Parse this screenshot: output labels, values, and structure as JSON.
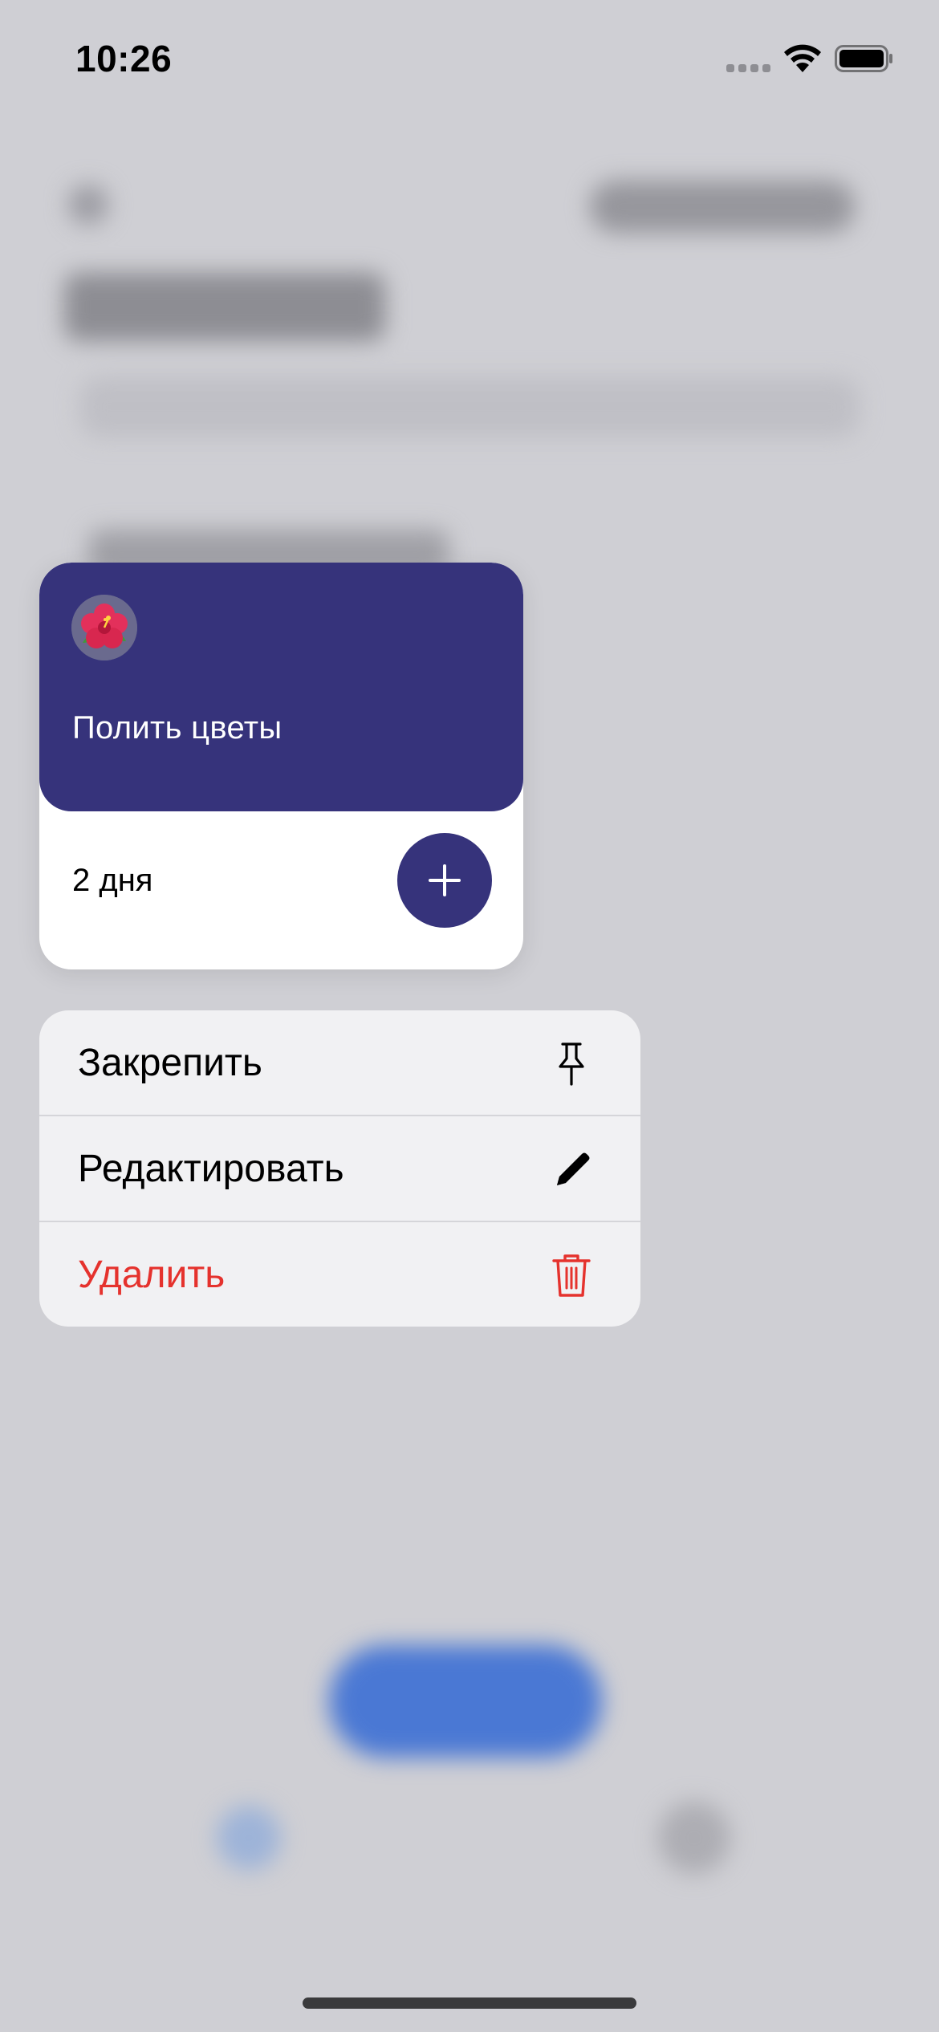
{
  "status_bar": {
    "time": "10:26",
    "signal_icon": "cellular-signal-icon",
    "wifi_icon": "wifi-icon",
    "battery_icon": "battery-icon"
  },
  "card": {
    "icon": "hibiscus-emoji-icon",
    "title": "Полить цветы",
    "duration": "2 дня",
    "add_icon": "plus-icon",
    "accent_color": "#36337b"
  },
  "context_menu": {
    "items": [
      {
        "label": "Закрепить",
        "icon": "pin-icon"
      },
      {
        "label": "Редактировать",
        "icon": "pencil-icon"
      },
      {
        "label": "Удалить",
        "icon": "trash-icon",
        "destructive": true,
        "color": "#e5322d"
      }
    ]
  }
}
